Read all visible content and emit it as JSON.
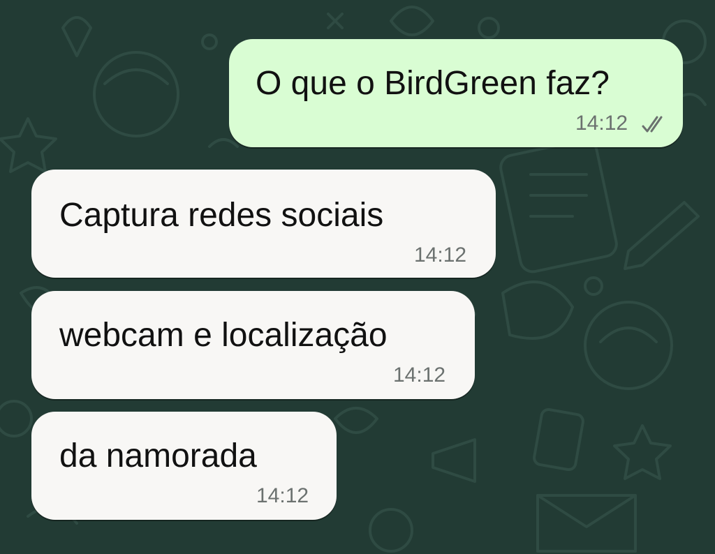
{
  "theme": {
    "background": "#223b34",
    "outgoing_bubble": "#d9fdd3",
    "incoming_bubble": "#f8f7f5",
    "time_color": "#6b716f",
    "tick_color": "#6b716f"
  },
  "messages": [
    {
      "direction": "outgoing",
      "text": "O que o BirdGreen faz?",
      "time": "14:12",
      "status_icon": "double-check-icon"
    },
    {
      "direction": "incoming",
      "text": "Captura redes sociais",
      "time": "14:12"
    },
    {
      "direction": "incoming",
      "text": "webcam e localização",
      "time": "14:12"
    },
    {
      "direction": "incoming",
      "text": "da namorada",
      "time": "14:12"
    }
  ]
}
